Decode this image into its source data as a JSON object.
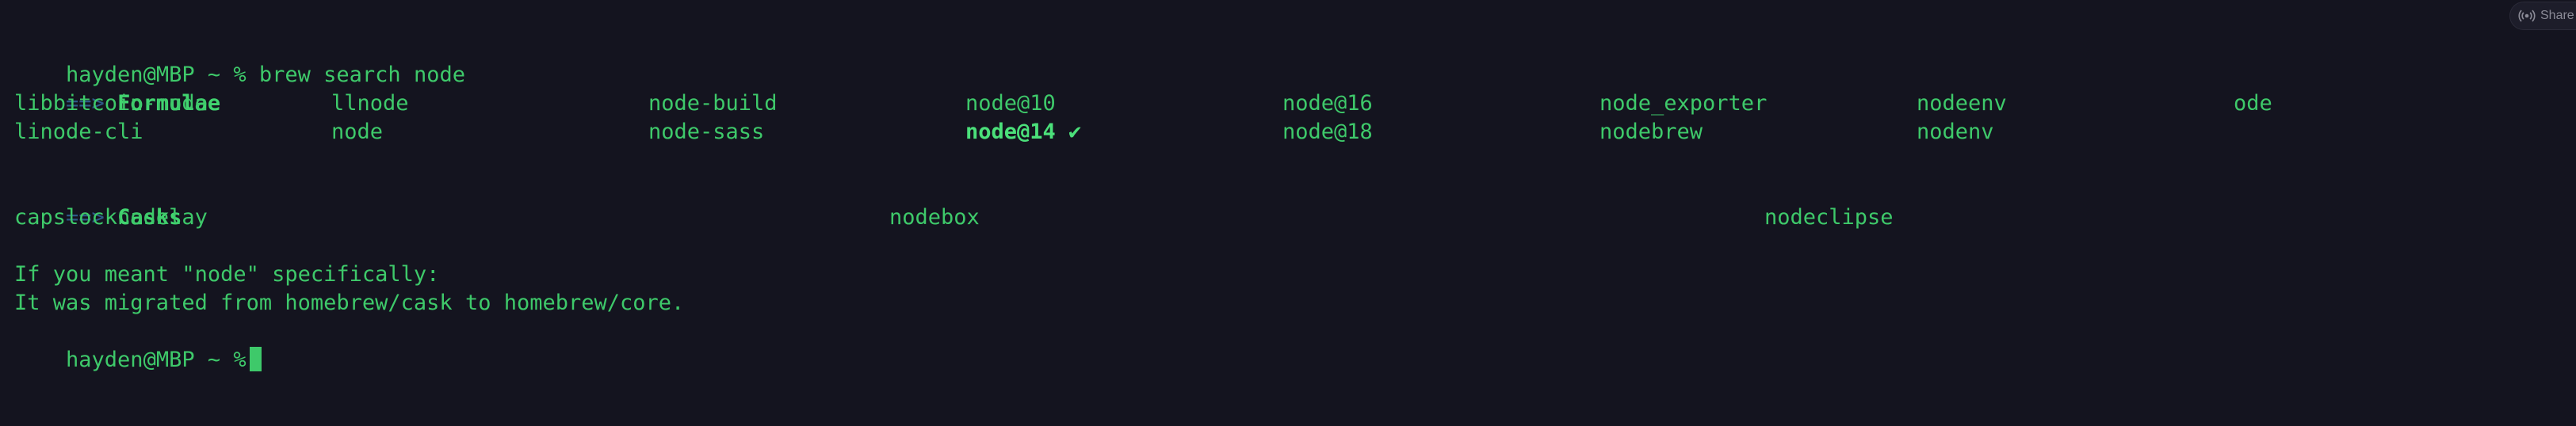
{
  "prompt": "hayden@MBP ~ %",
  "command": "brew search node",
  "arrow": "==>",
  "formulae": {
    "header": "Formulae",
    "row1": [
      "libbitcoin-node",
      "llnode",
      "node-build",
      "node@10",
      "node@16",
      "node_exporter",
      "nodeenv",
      "ode"
    ],
    "row2": [
      "linode-cli",
      "node",
      "node-sass",
      "node@14 ✔",
      "node@18",
      "nodebrew",
      "nodenv"
    ]
  },
  "casks": {
    "header": "Casks",
    "items": [
      "capslocknodelay",
      "nodebox",
      "nodeclipse"
    ]
  },
  "message": {
    "line1": "If you meant \"node\" specifically:",
    "line2": "It was migrated from homebrew/cask to homebrew/core."
  },
  "share_label": "Share",
  "colors": {
    "background": "#14141f",
    "text": "#3ec96a",
    "arrow": "#2d5a86"
  }
}
